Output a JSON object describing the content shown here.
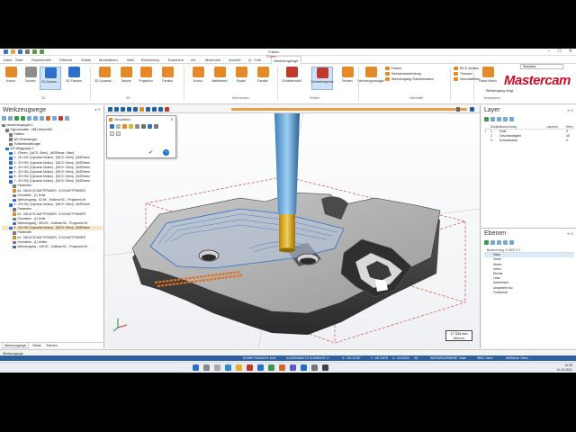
{
  "window": {
    "title": "Fräsen",
    "context_tab": "Fräsen",
    "controls": [
      "–",
      "☐",
      "✕"
    ]
  },
  "tabs": [
    "Datei",
    "Start",
    "Drahtmodell",
    "Flächen",
    "Solids",
    "Modellieren",
    "Netz",
    "Bemaßung",
    "Transform",
    "Art",
    "Maschine",
    "Ansicht",
    "Q - Tool",
    "Werkzeugwege"
  ],
  "ribbon": {
    "buttons": [
      {
        "label": "Kontur",
        "color": "#e58a2a"
      },
      {
        "label": "Bohren",
        "color": "#8c8c8c"
      },
      {
        "label": "2D-Dynam...",
        "color": "#2e6fc9"
      },
      {
        "label": "2D-Flanken",
        "color": "#2e6fc9"
      },
      {
        "label": "3D Dynamic...",
        "color": "#e58a2a"
      },
      {
        "label": "Tasche",
        "color": "#e58a2a"
      },
      {
        "label": "Projektion",
        "color": "#e58a2a"
      },
      {
        "label": "Parallel",
        "color": "#e58a2a"
      },
      {
        "label": "Kontur",
        "color": "#e58a2a"
      },
      {
        "label": "Waldfräsen",
        "color": "#e58a2a"
      },
      {
        "label": "Radial",
        "color": "#e58a2a"
      },
      {
        "label": "Parallel",
        "color": "#e58a2a"
      },
      {
        "label": "Rohteilmodell",
        "color": "#c0392b"
      },
      {
        "label": "Rohteilvergleich",
        "color": "#c0392b"
      },
      {
        "label": "Bohren",
        "color": "#e58a2a"
      },
      {
        "label": "Werkzeugmanager",
        "color": "#e58a2a"
      },
      {
        "label": "Paket öffnen",
        "color": "#e58a2a"
      }
    ],
    "groups": [
      "2D",
      "3D",
      "Mehrachsen",
      "Rohteil",
      "Hilfsmittel",
      "Analysieren"
    ],
    "list_mid": [
      "Fräsen",
      "Mehrachsverbindung",
      "Werkzeugweg-Transformation"
    ],
    "list_right": [
      "Ein E-Achsen",
      "Trimmen",
      "Verschachteln"
    ],
    "stock_compare": "Werkzeugweg-Vergleich",
    "brand": "Mastercam",
    "brand_select": "Standard"
  },
  "left_panel": {
    "title": "Werkzeugwege",
    "controls": "▾ ✕",
    "tree": [
      {
        "text": "Maschinengruppe-1",
        "icon": "#7a7a7a",
        "indent": 0
      },
      {
        "text": "Eigenschaften - Mill Default MM",
        "icon": "#7a7a7a",
        "indent": 1
      },
      {
        "text": "Dateien",
        "icon": "#7a7a7a",
        "indent": 2
      },
      {
        "text": "WZ-Einstellungen",
        "icon": "#7a7a7a",
        "indent": 2
      },
      {
        "text": "Rohteileinstellungen",
        "icon": "#7a7a7a",
        "indent": 2
      },
      {
        "text": "WZ-Weggruppe-1",
        "icon": "#2e6fc9",
        "indent": 1
      },
      {
        "text": "1 - Planen - [WCS: Oben] - [WZEbene: Oben]",
        "icon": "#2e6fc9",
        "indent": 2
      },
      {
        "text": "2 - 2D HSC (Dynamic Motion) - [WCS: Oben] - [WZEbene",
        "icon": "#2e6fc9",
        "indent": 2
      },
      {
        "text": "3 - 2D HSC (Dynamic Motion) - [WCS: Oben] - [WZEbene",
        "icon": "#2e6fc9",
        "indent": 2
      },
      {
        "text": "4 - 2D HSC (Dynamic Motion) - [WCS: Oben] - [WZEbene",
        "icon": "#2e6fc9",
        "indent": 2
      },
      {
        "text": "5 - 2D HSC (Dynamic Motion) - [WCS: Oben] - [WZEbene",
        "icon": "#2e6fc9",
        "indent": 2
      },
      {
        "text": "6 - 2D HSC (Dynamic Motion) - [WCS: Oben] - [WZEbene",
        "icon": "#2e6fc9",
        "indent": 2
      },
      {
        "text": "7 - 2D HSC (Dynamic Motion) - [WCS: Oben] - [WZEbene",
        "icon": "#2e6fc9",
        "indent": 2
      },
      {
        "text": "Parameter",
        "icon": "#7a7a7a",
        "indent": 3
      },
      {
        "text": "#4 - M8.00 SCHAFTFRÄSER - 8 SCHAFTFRÄSER",
        "icon": "#e58a2a",
        "indent": 3
      },
      {
        "text": "Geometrie - (1) Kette",
        "icon": "#7a7a7a",
        "indent": 3
      },
      {
        "text": "Werkzeugweg - 62.6K - Hollimar.NC - Programm-Nr",
        "icon": "#2e6fc9",
        "indent": 3
      },
      {
        "text": "8 - 2D HSC (Dynamic Motion) - [WCS: Oben] - [WZEbene",
        "icon": "#2e6fc9",
        "indent": 2
      },
      {
        "text": "Parameter",
        "icon": "#7a7a7a",
        "indent": 3
      },
      {
        "text": "#4 - M8.00 SCHAFTFRÄSER - 8 SCHAFTFRÄSER",
        "icon": "#e58a2a",
        "indent": 3
      },
      {
        "text": "Geometrie - (1) Kette",
        "icon": "#7a7a7a",
        "indent": 3
      },
      {
        "text": "Werkzeugweg - 563.0K - Hollimar.NC - Programm-Nr",
        "icon": "#2e6fc9",
        "indent": 3
      },
      {
        "text": "9 - 2D HSC (Dynamic Motion) - [WCS: Oben] - [WZEbene",
        "icon": "#2e6fc9",
        "indent": 2,
        "hl": true
      },
      {
        "text": "Parameter",
        "icon": "#7a7a7a",
        "indent": 3
      },
      {
        "text": "#4 - M8.00 SCHAFTFRÄSER - 8 SCHAFTFRÄSER",
        "icon": "#e58a2a",
        "indent": 3
      },
      {
        "text": "Geometrie - (1) Ketten",
        "icon": "#7a7a7a",
        "indent": 3
      },
      {
        "text": "Werkzeugweg - 448.2K - Hollimar.NC - Programm-Nr",
        "icon": "#2e6fc9",
        "indent": 3
      }
    ],
    "bottom_tabs": [
      "Werkzeugwege",
      "Solids",
      "Ebenen"
    ]
  },
  "sim_panel": {
    "title": "Simulation",
    "close": "✕",
    "ok": "✔",
    "help": "?"
  },
  "scale": {
    "value": "17.333 mm",
    "unit": "Metrisch"
  },
  "layer_panel": {
    "title": "Layer",
    "controls": "▾ ✕",
    "headers": [
      "",
      "Sichtbar",
      "Bezeichnung",
      "Layerset",
      "Elem"
    ],
    "rows": [
      [
        "✓",
        "1",
        "Solid",
        "",
        "3"
      ],
      [
        "",
        "2",
        "Geschwindigkeit",
        "",
        "45"
      ],
      [
        "",
        "3",
        "Schraubstock",
        "",
        "3"
      ]
    ]
  },
  "planes_panel": {
    "title": "Ebenen",
    "controls": "▾ ✕",
    "header": "Bezeichnung   G  WKS  K  Z",
    "rows": [
      "Oben",
      "Vorne",
      "Hinten",
      "Unten",
      "Rechts",
      "Links",
      "Isometrisch",
      "Umgekehrt Iso",
      "Trimetrisch"
    ],
    "selected": 0
  },
  "status": {
    "left": "Werkzeugwege",
    "items": [
      "SCHNITTANSICHT: AUS",
      "AUSGEWÄHLTE ELEMENTE: 0",
      "X: -101.22787",
      "Y: -68.74478",
      "Z: -10.00000",
      "3D",
      "WERKZEUGEBENE: Oben",
      "WKS: Oben",
      "WZEbene: Oben"
    ]
  },
  "tray": {
    "time": "12:28",
    "date": "14.01.2021"
  }
}
